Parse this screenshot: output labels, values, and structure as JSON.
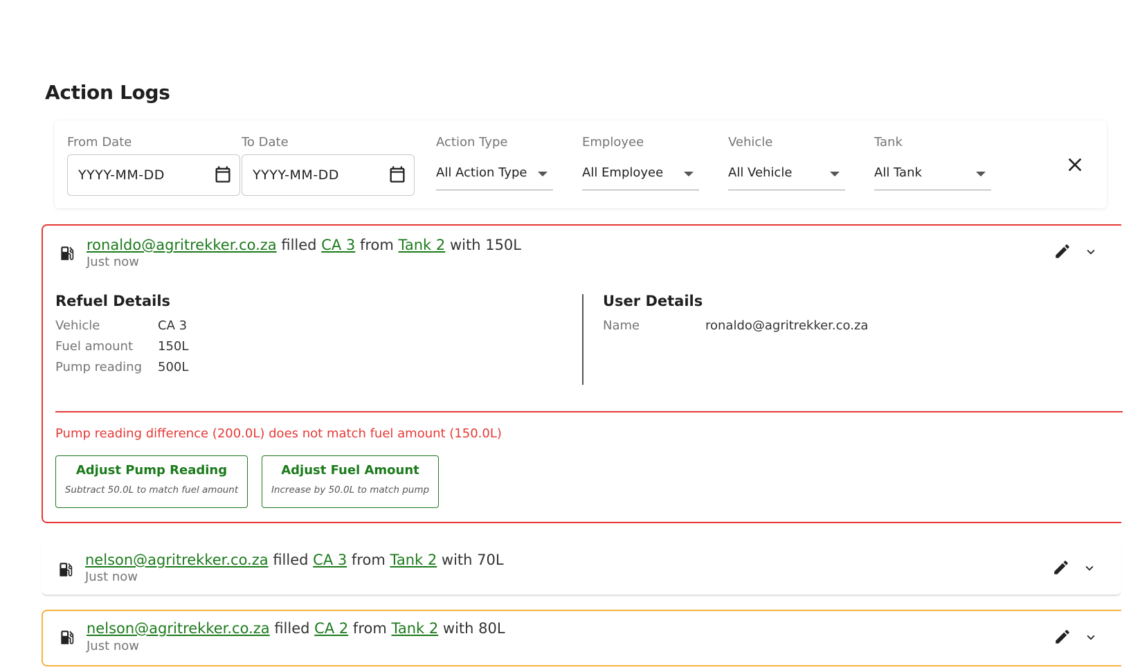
{
  "page": {
    "title": "Action Logs"
  },
  "filters": {
    "from_date": {
      "label": "From Date",
      "placeholder": "YYYY-MM-DD"
    },
    "to_date": {
      "label": "To Date",
      "placeholder": "YYYY-MM-DD"
    },
    "action_type": {
      "label": "Action Type",
      "value": "All Action Type"
    },
    "employee": {
      "label": "Employee",
      "value": "All Employee"
    },
    "vehicle": {
      "label": "Vehicle",
      "value": "All Vehicle"
    },
    "tank": {
      "label": "Tank",
      "value": "All Tank"
    },
    "clear_icon": "close-icon"
  },
  "logs": [
    {
      "status": "error",
      "user": "ronaldo@agritrekker.co.za",
      "verb1": "filled",
      "vehicle": "CA 3",
      "verb2": "from",
      "tank": "Tank 2",
      "verb3": "with",
      "amount": "150L",
      "time": "Just now",
      "expanded": true,
      "refuel_details": {
        "title": "Refuel Details",
        "rows": [
          {
            "key": "Vehicle",
            "value": "CA 3"
          },
          {
            "key": "Fuel amount",
            "value": "150L"
          },
          {
            "key": "Pump reading",
            "value": "500L"
          }
        ]
      },
      "user_details": {
        "title": "User Details",
        "rows": [
          {
            "key": "Name",
            "value": "ronaldo@agritrekker.co.za"
          }
        ]
      },
      "warning": "Pump reading difference (200.0L) does not match fuel amount (150.0L)",
      "actions": [
        {
          "title": "Adjust Pump Reading",
          "subtitle": "Subtract 50.0L to match fuel amount"
        },
        {
          "title": "Adjust Fuel Amount",
          "subtitle": "Increase by 50.0L to match pump"
        }
      ]
    },
    {
      "status": "normal",
      "user": "nelson@agritrekker.co.za",
      "verb1": "filled",
      "vehicle": "CA 3",
      "verb2": "from",
      "tank": "Tank 2",
      "verb3": "with",
      "amount": "70L",
      "time": "Just now",
      "expanded": false
    },
    {
      "status": "warning",
      "user": "nelson@agritrekker.co.za",
      "verb1": "filled",
      "vehicle": "CA 2",
      "verb2": "from",
      "tank": "Tank 2",
      "verb3": "with",
      "amount": "80L",
      "time": "Just now",
      "expanded": false
    }
  ],
  "colors": {
    "link_green": "#1b7a1b",
    "error_red": "#e53935",
    "warning_orange": "#f5b342"
  },
  "icons": {
    "log_icon": "fuel-pump-icon",
    "edit_icon": "pencil-icon",
    "expand_icon": "chevron-down-icon",
    "date_icon": "calendar-icon"
  }
}
